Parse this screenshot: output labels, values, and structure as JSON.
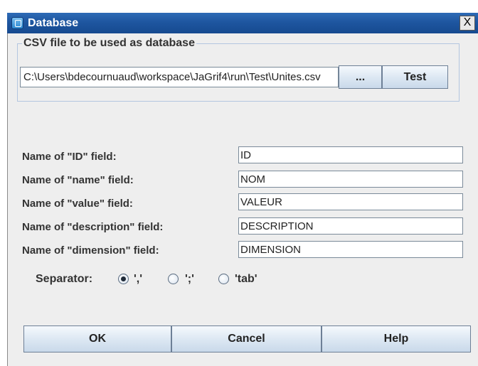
{
  "window": {
    "title": "Database",
    "close_label": "X"
  },
  "csv_group": {
    "legend": "CSV file to be used as database",
    "path_value": "C:\\Users\\bdecournuaud\\workspace\\JaGrif4\\run\\Test\\Unites.csv",
    "browse_label": "...",
    "test_label": "Test"
  },
  "fields": [
    {
      "label": "Name of \"ID\" field:",
      "value": "ID"
    },
    {
      "label": "Name of \"name\" field:",
      "value": "NOM"
    },
    {
      "label": "Name of \"value\" field:",
      "value": "VALEUR"
    },
    {
      "label": "Name of \"description\" field:",
      "value": "DESCRIPTION"
    },
    {
      "label": "Name of \"dimension\" field:",
      "value": "DIMENSION"
    }
  ],
  "separator": {
    "label": "Separator:",
    "options": [
      {
        "label": "','",
        "checked": true
      },
      {
        "label": "';'",
        "checked": false
      },
      {
        "label": "'tab'",
        "checked": false
      }
    ]
  },
  "buttons": {
    "ok": "OK",
    "cancel": "Cancel",
    "help": "Help"
  }
}
